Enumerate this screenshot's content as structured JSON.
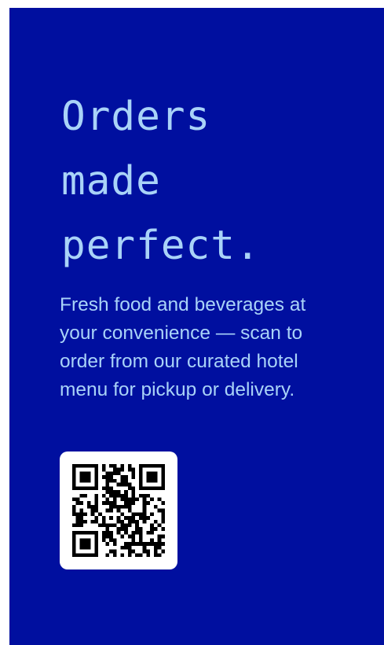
{
  "poster": {
    "headline_lines": [
      "Orders",
      "made",
      "perfect."
    ],
    "body_lines": [
      "Fresh food and beverages at",
      "your convenience — scan to",
      "order from our curated hotel",
      "menu for pickup or delivery."
    ],
    "qr_icon": "qr-code-icon"
  },
  "colors": {
    "background": "#000f9f",
    "text": "#a9d3f8",
    "qr_card": "#ffffff",
    "qr_modules": "#000000"
  }
}
